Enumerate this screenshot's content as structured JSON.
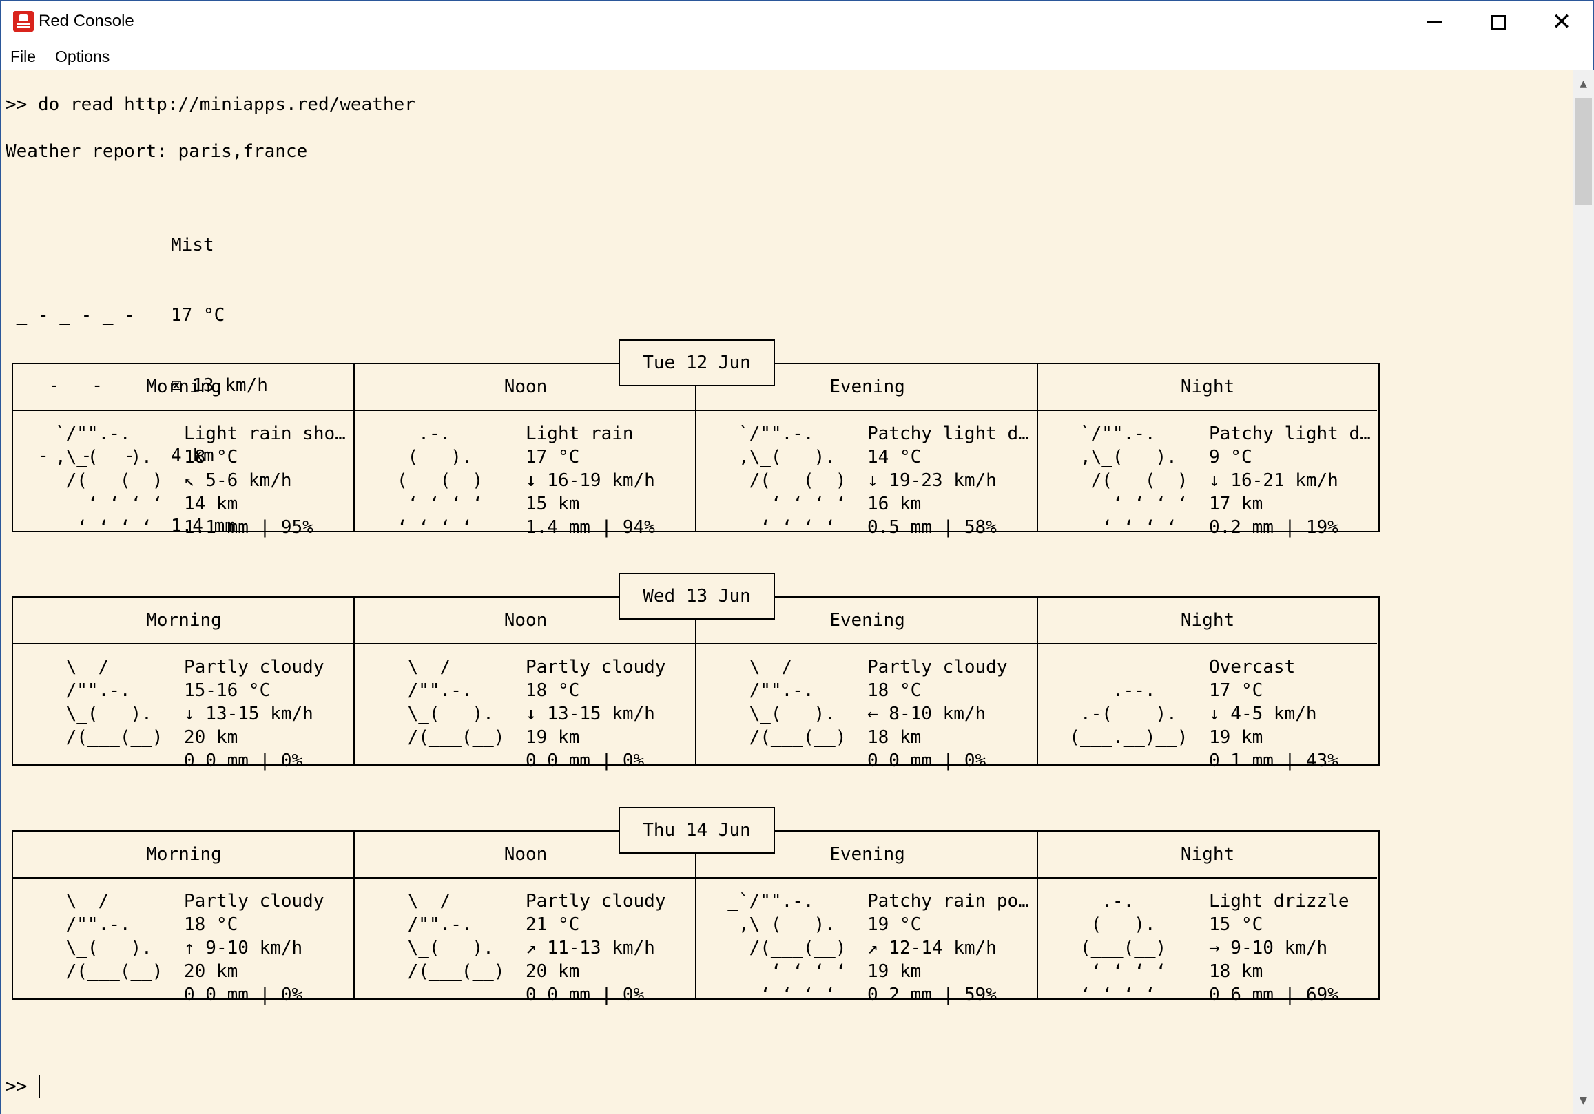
{
  "window": {
    "title": "Red Console"
  },
  "menu": [
    "File",
    "Options"
  ],
  "console": {
    "command_line": ">> do read http://miniapps.red/weather",
    "report_line": "Weather report: paris,france",
    "current": {
      "art": [
        "",
        " _ - _ - _ -",
        "  _ - _ - _",
        " _ - _ - _ -",
        ""
      ],
      "info": [
        "Mist",
        "17 °C",
        "⊠ 13 km/h",
        "4 km",
        "1.4 mm"
      ]
    },
    "prompt": ">> "
  },
  "days": [
    {
      "date": "Tue 12 Jun",
      "periods": [
        {
          "name": "Morning",
          "art": [
            "  _`/\"\".-.",
            "   ,\\_(   ).",
            "    /(___(__)",
            "      ‘ ‘ ‘ ‘",
            "     ‘ ‘ ‘ ‘"
          ],
          "info": [
            "Light rain sho…",
            "18 °C",
            "↖ 5-6 km/h",
            "14 km",
            "1.1 mm | 95%"
          ]
        },
        {
          "name": "Noon",
          "art": [
            "     .-.",
            "    (   ).",
            "   (___(__)",
            "    ‘ ‘ ‘ ‘",
            "   ‘ ‘ ‘ ‘"
          ],
          "info": [
            "Light rain",
            "17 °C",
            "↓ 16-19 km/h",
            "15 km",
            "1.4 mm | 94%"
          ]
        },
        {
          "name": "Evening",
          "art": [
            "  _`/\"\".-.",
            "   ,\\_(   ).",
            "    /(___(__)",
            "      ‘ ‘ ‘ ‘",
            "     ‘ ‘ ‘ ‘"
          ],
          "info": [
            "Patchy light d…",
            "14 °C",
            "↓ 19-23 km/h",
            "16 km",
            "0.5 mm | 58%"
          ]
        },
        {
          "name": "Night",
          "art": [
            "  _`/\"\".-.",
            "   ,\\_(   ).",
            "    /(___(__)",
            "      ‘ ‘ ‘ ‘",
            "     ‘ ‘ ‘ ‘"
          ],
          "info": [
            "Patchy light d…",
            "9 °C",
            "↓ 16-21 km/h",
            "17 km",
            "0.2 mm | 19%"
          ]
        }
      ]
    },
    {
      "date": "Wed 13 Jun",
      "periods": [
        {
          "name": "Morning",
          "art": [
            "    \\  /",
            "  _ /\"\".-.",
            "    \\_(   ).",
            "    /(___(__)",
            ""
          ],
          "info": [
            "Partly cloudy",
            "15-16 °C",
            "↓ 13-15 km/h",
            "20 km",
            "0.0 mm | 0%"
          ]
        },
        {
          "name": "Noon",
          "art": [
            "    \\  /",
            "  _ /\"\".-.",
            "    \\_(   ).",
            "    /(___(__)",
            ""
          ],
          "info": [
            "Partly cloudy",
            "18 °C",
            "↓ 13-15 km/h",
            "19 km",
            "0.0 mm | 0%"
          ]
        },
        {
          "name": "Evening",
          "art": [
            "    \\  /",
            "  _ /\"\".-.",
            "    \\_(   ).",
            "    /(___(__)",
            ""
          ],
          "info": [
            "Partly cloudy",
            "18 °C",
            "← 8-10 km/h",
            "18 km",
            "0.0 mm | 0%"
          ]
        },
        {
          "name": "Night",
          "art": [
            "",
            "      .--.",
            "   .-(    ).",
            "  (___.__)__)",
            ""
          ],
          "info": [
            "Overcast",
            "17 °C",
            "↓ 4-5 km/h",
            "19 km",
            "0.1 mm | 43%"
          ]
        }
      ]
    },
    {
      "date": "Thu 14 Jun",
      "periods": [
        {
          "name": "Morning",
          "art": [
            "    \\  /",
            "  _ /\"\".-.",
            "    \\_(   ).",
            "    /(___(__)",
            ""
          ],
          "info": [
            "Partly cloudy",
            "18 °C",
            "↑ 9-10 km/h",
            "20 km",
            "0.0 mm | 0%"
          ]
        },
        {
          "name": "Noon",
          "art": [
            "    \\  /",
            "  _ /\"\".-.",
            "    \\_(   ).",
            "    /(___(__)",
            ""
          ],
          "info": [
            "Partly cloudy",
            "21 °C",
            "↗ 11-13 km/h",
            "20 km",
            "0.0 mm | 0%"
          ]
        },
        {
          "name": "Evening",
          "art": [
            "  _`/\"\".-.",
            "   ,\\_(   ).",
            "    /(___(__)",
            "      ‘ ‘ ‘ ‘",
            "     ‘ ‘ ‘ ‘"
          ],
          "info": [
            "Patchy rain po…",
            "19 °C",
            "↗ 12-14 km/h",
            "19 km",
            "0.2 mm | 59%"
          ]
        },
        {
          "name": "Night",
          "art": [
            "     .-.",
            "    (   ).",
            "   (___(__)",
            "    ‘ ‘ ‘ ‘",
            "   ‘ ‘ ‘ ‘"
          ],
          "info": [
            "Light drizzle",
            "15 °C",
            "→ 9-10 km/h",
            "18 km",
            "0.6 mm | 69%"
          ]
        }
      ]
    }
  ]
}
